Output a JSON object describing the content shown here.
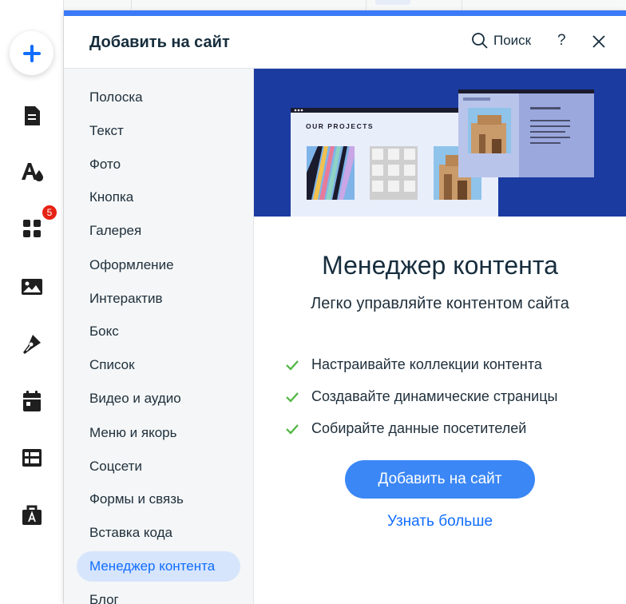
{
  "panel": {
    "title": "Добавить на сайт",
    "search_label": "Поиск",
    "help_label": "?"
  },
  "rail": {
    "badge_count": "5",
    "icons": [
      "plus-icon",
      "page-icon",
      "theme-icon",
      "apps-icon",
      "media-icon",
      "pen-icon",
      "calendar-icon",
      "table-icon",
      "portfolio-icon"
    ]
  },
  "categories": [
    "Полоска",
    "Текст",
    "Фото",
    "Кнопка",
    "Галерея",
    "Оформление",
    "Интерактив",
    "Бокс",
    "Список",
    "Видео и аудио",
    "Меню и якорь",
    "Соцсети",
    "Формы и связь",
    "Вставка кода",
    "Менеджер контента",
    "Блог"
  ],
  "active_category": "Менеджер контента",
  "content": {
    "hero_label": "OUR PROJECTS",
    "title": "Менеджер контента",
    "subtitle": "Легко управляйте контентом сайта",
    "features": [
      "Настраивайте коллекции контента",
      "Создавайте динамические страницы",
      "Собирайте данные посетителей"
    ],
    "add_button": "Добавить на сайт",
    "learn_more": "Узнать больше"
  },
  "colors": {
    "accent": "#116dff",
    "primary_button": "#3b87f5",
    "hero_bg": "#1b3ba1",
    "check": "#4eb43f",
    "badge": "#e62214"
  }
}
